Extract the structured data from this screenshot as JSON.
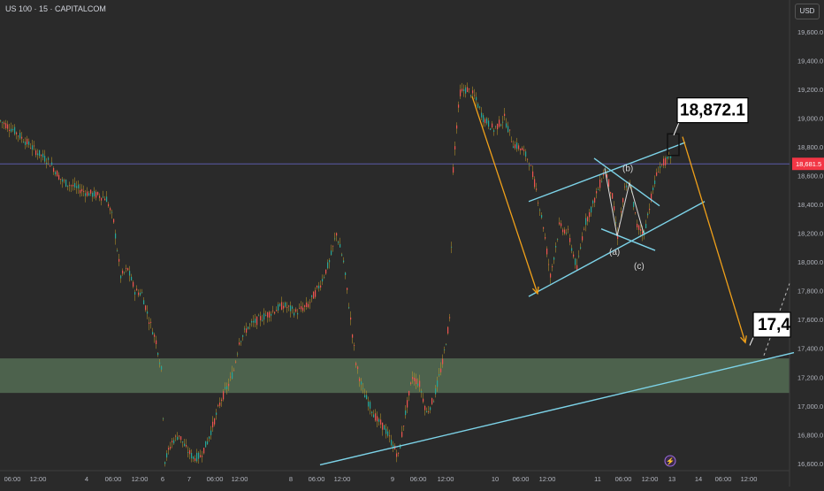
{
  "header": {
    "symbol_title": "US 100 · 15 · CAPITALCOM",
    "currency": "USD"
  },
  "chart_data": {
    "type": "line",
    "price_path": {
      "name": "",
      "points": [
        [
          0,
          18980
        ],
        [
          14,
          18920
        ],
        [
          28,
          18840
        ],
        [
          42,
          18760
        ],
        [
          56,
          18690
        ],
        [
          70,
          18560
        ],
        [
          84,
          18520
        ],
        [
          98,
          18480
        ],
        [
          112,
          18460
        ],
        [
          120,
          18440
        ],
        [
          128,
          18280
        ],
        [
          136,
          17900
        ],
        [
          144,
          17950
        ],
        [
          152,
          17800
        ],
        [
          160,
          17780
        ],
        [
          168,
          17600
        ],
        [
          176,
          17450
        ],
        [
          182,
          17250
        ],
        [
          186,
          16620
        ],
        [
          194,
          16750
        ],
        [
          202,
          16800
        ],
        [
          210,
          16700
        ],
        [
          218,
          16640
        ],
        [
          226,
          16650
        ],
        [
          234,
          16750
        ],
        [
          242,
          16900
        ],
        [
          250,
          17050
        ],
        [
          258,
          17150
        ],
        [
          264,
          17250
        ],
        [
          270,
          17450
        ],
        [
          280,
          17550
        ],
        [
          292,
          17600
        ],
        [
          306,
          17650
        ],
        [
          320,
          17700
        ],
        [
          334,
          17650
        ],
        [
          348,
          17700
        ],
        [
          362,
          17850
        ],
        [
          372,
          18000
        ],
        [
          380,
          18200
        ],
        [
          388,
          18000
        ],
        [
          396,
          17600
        ],
        [
          402,
          17300
        ],
        [
          410,
          17100
        ],
        [
          418,
          17000
        ],
        [
          426,
          16900
        ],
        [
          434,
          16850
        ],
        [
          442,
          16750
        ],
        [
          450,
          16650
        ],
        [
          458,
          16950
        ],
        [
          466,
          17200
        ],
        [
          474,
          17150
        ],
        [
          482,
          16950
        ],
        [
          490,
          17050
        ],
        [
          500,
          17300
        ],
        [
          508,
          17600
        ],
        [
          512,
          18650
        ],
        [
          516,
          18950
        ],
        [
          520,
          19180
        ],
        [
          528,
          19200
        ],
        [
          536,
          19150
        ],
        [
          546,
          19000
        ],
        [
          558,
          18920
        ],
        [
          570,
          19000
        ],
        [
          580,
          18820
        ],
        [
          590,
          18780
        ],
        [
          598,
          18700
        ],
        [
          606,
          18500
        ],
        [
          614,
          18250
        ],
        [
          622,
          17900
        ],
        [
          632,
          18250
        ],
        [
          642,
          18200
        ],
        [
          652,
          17950
        ],
        [
          660,
          18250
        ],
        [
          670,
          18400
        ],
        [
          684,
          18650
        ],
        [
          692,
          18450
        ],
        [
          698,
          18180
        ],
        [
          706,
          18500
        ],
        [
          712,
          18550
        ],
        [
          720,
          18250
        ],
        [
          728,
          18200
        ],
        [
          736,
          18450
        ],
        [
          744,
          18650
        ],
        [
          752,
          18700
        ],
        [
          760,
          18720
        ]
      ]
    },
    "current_price": 18681.5,
    "annotations": {
      "upper_target": "18,872.1",
      "lower_target": "17,4",
      "wave_a": "(a)",
      "wave_b": "(b)",
      "wave_c": "(c)"
    },
    "y_axis": {
      "ticks": [
        19600,
        19400,
        19200,
        19000,
        18800,
        18600,
        18400,
        18200,
        18000,
        17800,
        17600,
        17400,
        17200,
        17000,
        16800,
        16600
      ],
      "tick_labels": [
        "19,600.0",
        "19,400.0",
        "19,200.0",
        "19,000.0",
        "18,800.0",
        "18,600.0",
        "18,400.0",
        "18,200.0",
        "18,000.0",
        "17,800.0",
        "17,600.0",
        "17,400.0",
        "17,200.0",
        "17,000.0",
        "16,800.0",
        "16,600.0"
      ],
      "current_label": "18,681.5",
      "range": [
        16550,
        19820
      ]
    },
    "x_axis": {
      "labels": [
        "06:00",
        "12:00",
        "4",
        "06:00",
        "12:00",
        "6",
        "7",
        "06:00",
        "12:00",
        "8",
        "06:00",
        "12:00",
        "9",
        "06:00",
        "12:00",
        "10",
        "06:00",
        "12:00",
        "11",
        "06:00",
        "12:00",
        "13",
        "14",
        "06:00",
        "12:00"
      ],
      "positions": [
        14,
        43,
        98,
        128,
        158,
        184,
        214,
        243,
        271,
        329,
        358,
        387,
        444,
        473,
        504,
        560,
        589,
        619,
        676,
        705,
        735,
        760,
        790,
        818,
        847
      ]
    },
    "demand_zone": [
      17090,
      17330
    ],
    "colors": {
      "up": "#26a69a",
      "down": "#ef5350",
      "wick": "#c9a227",
      "arrow": "#f0a019",
      "channel": "#7dd3e8",
      "zone": "#5c7a5c",
      "price_line": "#5a5aa8",
      "price_tag": "#f23645"
    }
  }
}
